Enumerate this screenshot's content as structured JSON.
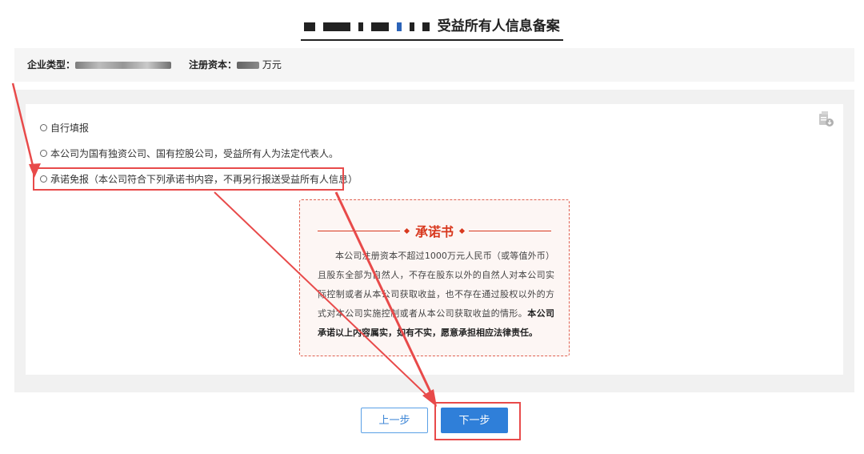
{
  "page": {
    "title_suffix": "受益所有人信息备案"
  },
  "info_bar": {
    "company_type_label": "企业类型：",
    "registered_capital_label": "注册资本：",
    "registered_capital_unit": "万元"
  },
  "options": [
    {
      "label": "自行填报"
    },
    {
      "label": "本公司为国有独资公司、国有控股公司，受益所有人为法定代表人。"
    },
    {
      "label": "承诺免报（本公司符合下列承诺书内容，不再另行报送受益所有人信息）"
    }
  ],
  "promise": {
    "heading": "承诺书",
    "body": "本公司注册资本不超过1000万元人民币（或等值外币）且股东全部为自然人，不存在股东以外的自然人对本公司实际控制或者从本公司获取收益，也不存在通过股权以外的方式对本公司实施控制或者从本公司获取收益的情形。",
    "body_bold": "本公司承诺以上内容属实，如有不实，愿意承担相应法律责任。"
  },
  "buttons": {
    "prev": "上一步",
    "next": "下一步"
  },
  "colors": {
    "accent_blue": "#2f7fd9",
    "promise_red": "#d8381e",
    "annotation_red": "#e84a4a"
  },
  "icons": {
    "doc": "document-download-icon"
  }
}
